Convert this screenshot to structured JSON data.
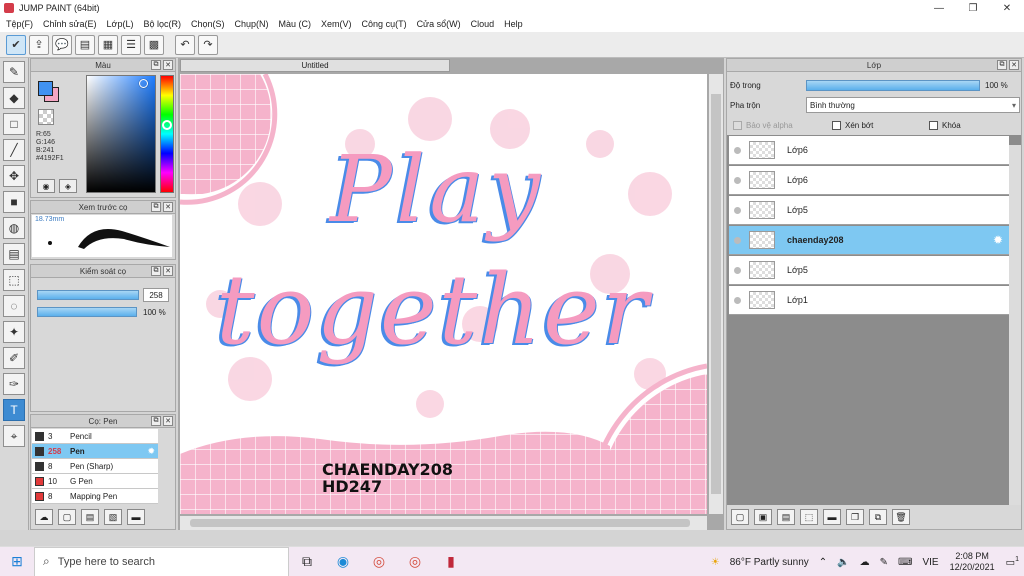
{
  "window": {
    "title": "JUMP PAINT (64bit)",
    "minimize": "—",
    "maximize": "❐",
    "close": "✕"
  },
  "menu": [
    "Tệp(F)",
    "Chỉnh sửa(E)",
    "Lớp(L)",
    "Bộ lọc(R)",
    "Chọn(S)",
    "Chụp(N)",
    "Màu (C)",
    "Xem(V)",
    "Công cụ(T)",
    "Cửa sổ(W)",
    "Cloud",
    "Help"
  ],
  "color_panel": {
    "title": "Màu",
    "r": "R:65",
    "g": "G:146",
    "b": "B:241",
    "hex": "#4192F1",
    "fg_color": "#4192f1",
    "bg_color": "#f5a6c3"
  },
  "brush_preview": {
    "title": "Xem trước cọ",
    "size": "18.73mm"
  },
  "brush_control": {
    "title": "Kiểm soát cọ",
    "size_value": "258",
    "opacity_value": "100 %"
  },
  "brush_list": {
    "title": "Cọ: Pen",
    "items": [
      {
        "size": "3",
        "name": "Pencil",
        "color": "#333333"
      },
      {
        "size": "258",
        "name": "Pen",
        "color": "#d43c4a"
      },
      {
        "size": "8",
        "name": "Pen (Sharp)",
        "color": "#333333"
      },
      {
        "size": "10",
        "name": "G Pen",
        "color": "#e23a3a"
      },
      {
        "size": "8",
        "name": "Mapping Pen",
        "color": "#e23a3a"
      }
    ]
  },
  "canvas": {
    "tab_title": "Untitled",
    "art_line1": "Play",
    "art_line2": "together",
    "sig_line1": "CHAENDAY208",
    "sig_line2": "HD247"
  },
  "layer_panel": {
    "title": "Lớp",
    "opacity_label": "Độ trong",
    "opacity_value": "100 %",
    "blend_label": "Pha trộn",
    "blend_value": "Bình thường",
    "protect_alpha": "Bảo vệ alpha",
    "clipping": "Xén bớt",
    "lock": "Khóa",
    "layers": [
      {
        "name": "Lớp6"
      },
      {
        "name": "Lớp6"
      },
      {
        "name": "Lớp5"
      },
      {
        "name": "chaenday208"
      },
      {
        "name": "Lớp5"
      },
      {
        "name": "Lớp1"
      }
    ]
  },
  "taskbar": {
    "search_placeholder": "Type here to search",
    "weather": "86°F  Partly sunny",
    "lang": "VIE",
    "time": "2:08 PM",
    "date": "12/20/2021",
    "notif_count": "1"
  }
}
